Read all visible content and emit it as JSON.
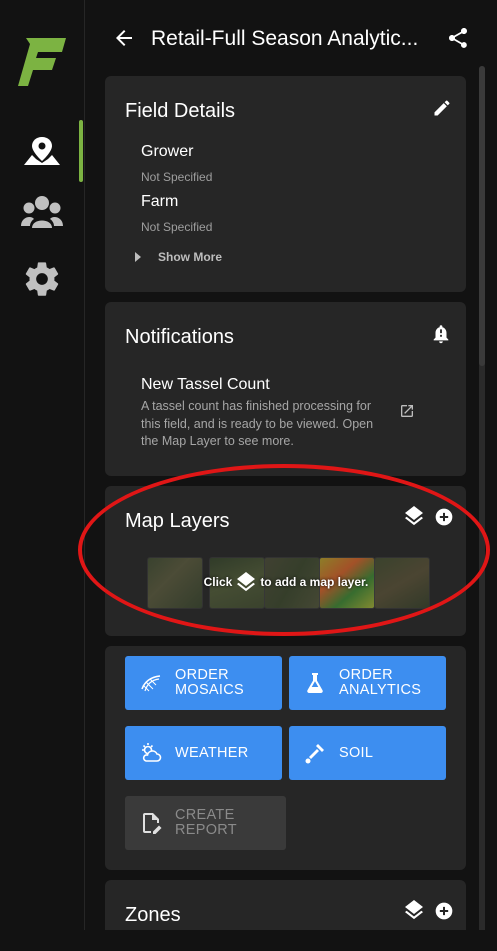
{
  "header": {
    "title": "Retail-Full Season Analytic..."
  },
  "field_details": {
    "title": "Field Details",
    "grower_label": "Grower",
    "grower_value": "Not Specified",
    "farm_label": "Farm",
    "farm_value": "Not Specified",
    "show_more": "Show More"
  },
  "notifications": {
    "title": "Notifications",
    "item_title": "New Tassel Count",
    "item_body": "A tassel count has finished processing for this field, and is ready to be viewed. Open the Map Layer to see more."
  },
  "map_layers": {
    "title": "Map Layers",
    "hint_prefix": "Click",
    "hint_suffix": "to add a map layer."
  },
  "actions": {
    "order_mosaics": [
      "ORDER",
      "MOSAICS"
    ],
    "order_analytics": [
      "ORDER",
      "ANALYTICS"
    ],
    "weather": "WEATHER",
    "soil": "SOIL",
    "create_report": [
      "CREATE",
      "REPORT"
    ]
  },
  "zones": {
    "title": "Zones"
  },
  "colors": {
    "accent": "#3d8ef0",
    "brand_green": "#7cb342",
    "annotation_red": "#e01616"
  },
  "icons": [
    "logo-icon",
    "map-pin-icon",
    "people-icon",
    "gear-icon",
    "back-arrow-icon",
    "share-icon",
    "edit-icon",
    "bell-icon",
    "open-external-icon",
    "layers-icon",
    "add-circle-icon",
    "drone-icon",
    "flask-icon",
    "weather-icon",
    "soil-probe-icon",
    "report-icon"
  ]
}
